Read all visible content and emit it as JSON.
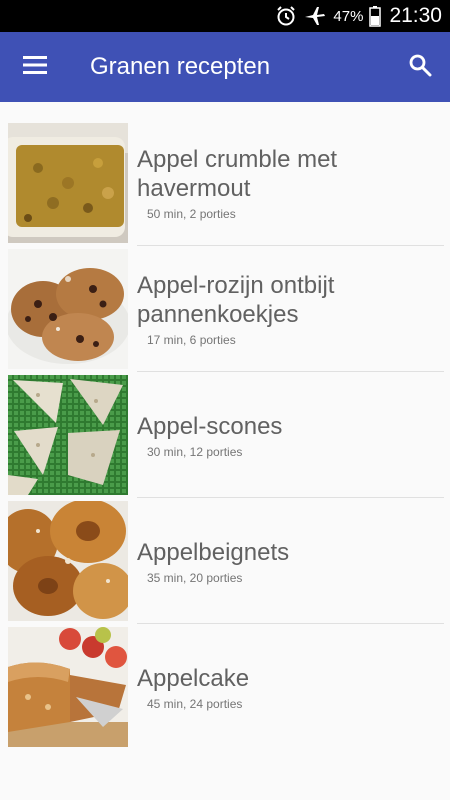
{
  "status_bar": {
    "battery_percent": "47%",
    "time": "21:30",
    "icons": [
      "alarm-icon",
      "airplane-mode-icon",
      "battery-icon"
    ]
  },
  "app_bar": {
    "title": "Granen recepten",
    "menu_icon": "hamburger-menu-icon",
    "search_icon": "search-icon",
    "color": "#3f51b5"
  },
  "recipes": [
    {
      "title": "Appel crumble met havermout",
      "meta": "50 min, 2 porties",
      "image": "apple-crumble-photo"
    },
    {
      "title": "Appel-rozijn ontbijt pannenkoekjes",
      "meta": "17 min, 6 porties",
      "image": "raisin-pancakes-photo"
    },
    {
      "title": "Appel-scones",
      "meta": "30 min, 12 porties",
      "image": "scones-photo"
    },
    {
      "title": "Appelbeignets",
      "meta": "35 min, 20 porties",
      "image": "apple-fritters-photo"
    },
    {
      "title": "Appelcake",
      "meta": "45 min, 24 porties",
      "image": "apple-cake-photo"
    }
  ]
}
